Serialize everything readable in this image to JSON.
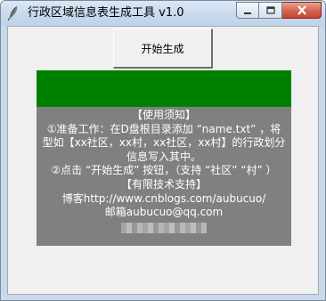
{
  "window": {
    "title": "行政区域信息表生成工具 v1.0"
  },
  "caption_buttons": {
    "minimize_icon": "minimize-icon",
    "maximize_icon": "maximize-icon",
    "close_icon": "close-icon"
  },
  "toolbar": {
    "start_label": "开始生成"
  },
  "status_bar": {
    "color": "#008000"
  },
  "info": {
    "background": "#808080",
    "lines": [
      "【使用须知】",
      "①准备工作：在D盘根目录添加 “name.txt” ，将",
      "型如【xx社区，xx村，xx社区，xx村】的行政划分",
      "信息写入其中。",
      "②点击 “开始生成” 按钮，（支持 “社区” “村” ）",
      "【有限技术支持】",
      "博客http://www.cnblogs.com/aubucuo/",
      "邮箱aubucuo@qq.com"
    ]
  }
}
